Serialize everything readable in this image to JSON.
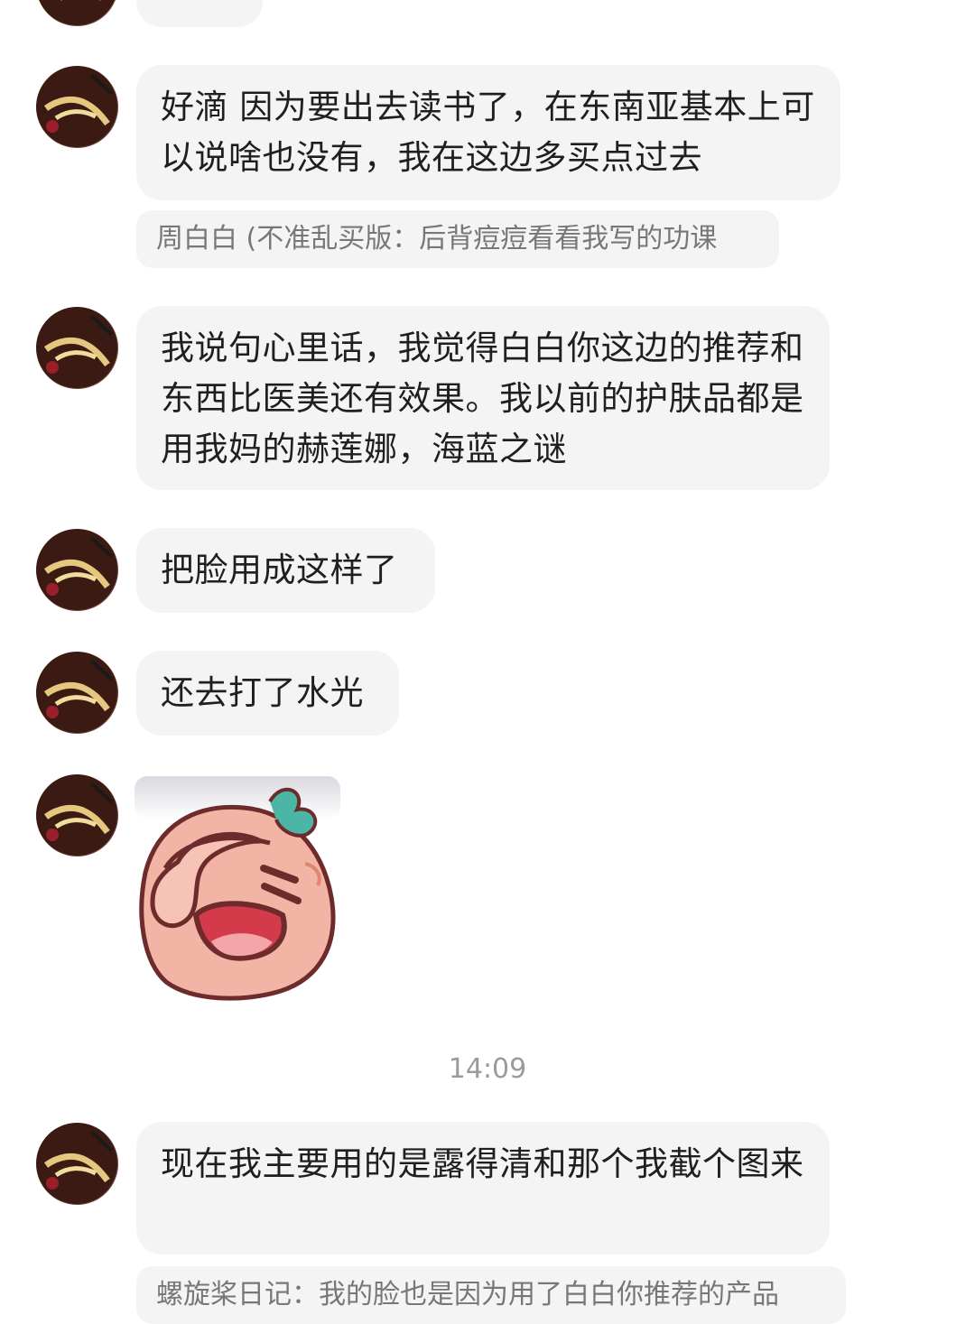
{
  "messages": [
    {
      "text": "好滴 因为要出去读书了，在东南亚基本上可以说啥也没有，我在这边多买点过去",
      "quote": "周白白 (不准乱买版：后背痘痘看看我写的功课"
    },
    {
      "text": "我说句心里话，我觉得白白你这边的推荐和东西比医美还有效果。我以前的护肤品都是用我妈的赫莲娜，海蓝之谜"
    },
    {
      "text": "把脸用成这样了"
    },
    {
      "text": "还去打了水光"
    },
    {
      "sticker": "facepalm-peach-sticker"
    },
    {
      "timestamp": "14:09"
    },
    {
      "text": "现在我主要用的是露得清和那个我截个图来",
      "quote": "螺旋桨日记：我的脸也是因为用了白白你推荐的产品"
    }
  ],
  "colors": {
    "bubble_bg": "#f4f4f4",
    "quote_text": "#777777",
    "timestamp_text": "#9b9b9b"
  }
}
